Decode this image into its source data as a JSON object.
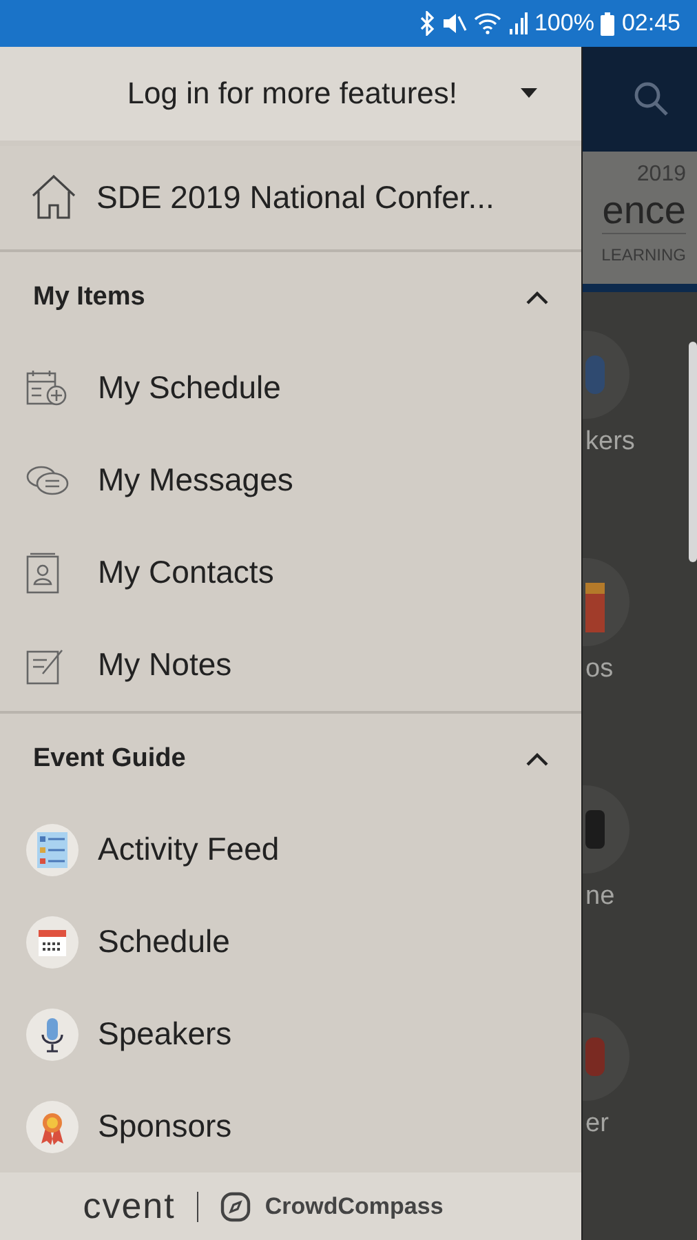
{
  "status_bar": {
    "battery": "100%",
    "time": "02:45"
  },
  "drawer": {
    "login": "Log in for more features!",
    "event": "SDE 2019 National Confer...",
    "sections": [
      {
        "title": "My Items",
        "expanded": true,
        "items": [
          {
            "label": "My Schedule"
          },
          {
            "label": "My Messages"
          },
          {
            "label": "My Contacts"
          },
          {
            "label": "My Notes"
          }
        ]
      },
      {
        "title": "Event Guide",
        "expanded": true,
        "items": [
          {
            "label": "Activity Feed"
          },
          {
            "label": "Schedule"
          },
          {
            "label": "Speakers"
          },
          {
            "label": "Sponsors"
          }
        ]
      }
    ],
    "footer": {
      "brand": "cvent",
      "partner": "CrowdCompass"
    }
  },
  "background": {
    "year": "2019",
    "title_fragment": "ence",
    "subtitle_fragment": "LEARNING",
    "tiles": [
      {
        "label": "kers"
      },
      {
        "label": "os"
      },
      {
        "label": "ne"
      },
      {
        "label": "er"
      }
    ]
  }
}
